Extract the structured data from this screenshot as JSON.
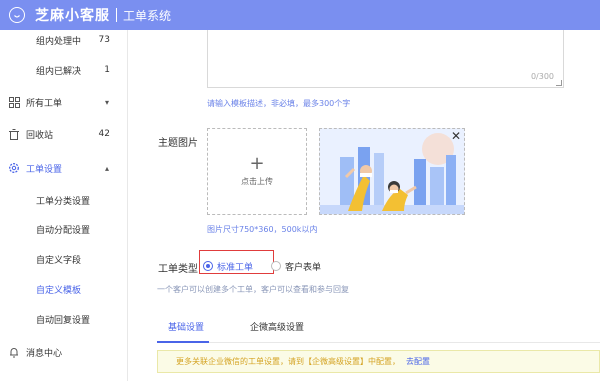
{
  "header": {
    "brand": "芝麻小客服",
    "system": "工单系统"
  },
  "sidebar": {
    "items": [
      {
        "label": "组内处理中",
        "count": "73"
      },
      {
        "label": "组内已解决",
        "count": "1"
      },
      {
        "label": "所有工单",
        "icon": "grid-icon",
        "chevron": "▾"
      },
      {
        "label": "回收站",
        "count": "42",
        "icon": "trash-icon"
      },
      {
        "label": "工单设置",
        "icon": "gear-icon",
        "chevron": "▴"
      },
      {
        "label": "工单分类设置"
      },
      {
        "label": "自动分配设置"
      },
      {
        "label": "自定义字段"
      },
      {
        "label": "自定义模板"
      },
      {
        "label": "自动回复设置"
      },
      {
        "label": "消息中心",
        "icon": "bell-icon"
      }
    ]
  },
  "form": {
    "textarea_count": "0/300",
    "textarea_hint": "请输入模板描述，非必填，最多300个字",
    "image_label": "主题图片",
    "upload_label": "点击上传",
    "image_hint": "图片尺寸750*360，500k以内",
    "type_label": "工单类型",
    "type_options": [
      "标准工单",
      "客户表单"
    ],
    "type_hint": "一个客户可以创建多个工单，客户可以查看和参与回复"
  },
  "tabs": [
    "基础设置",
    "企微高级设置"
  ],
  "notice": {
    "text": "更多关联企业微信的工单设置，请到【企微高级设置】中配置，",
    "link": "去配置"
  },
  "colors": {
    "header": "#7a8ff0",
    "accent": "#4a64e8",
    "highlight_border": "#e03c3c"
  }
}
